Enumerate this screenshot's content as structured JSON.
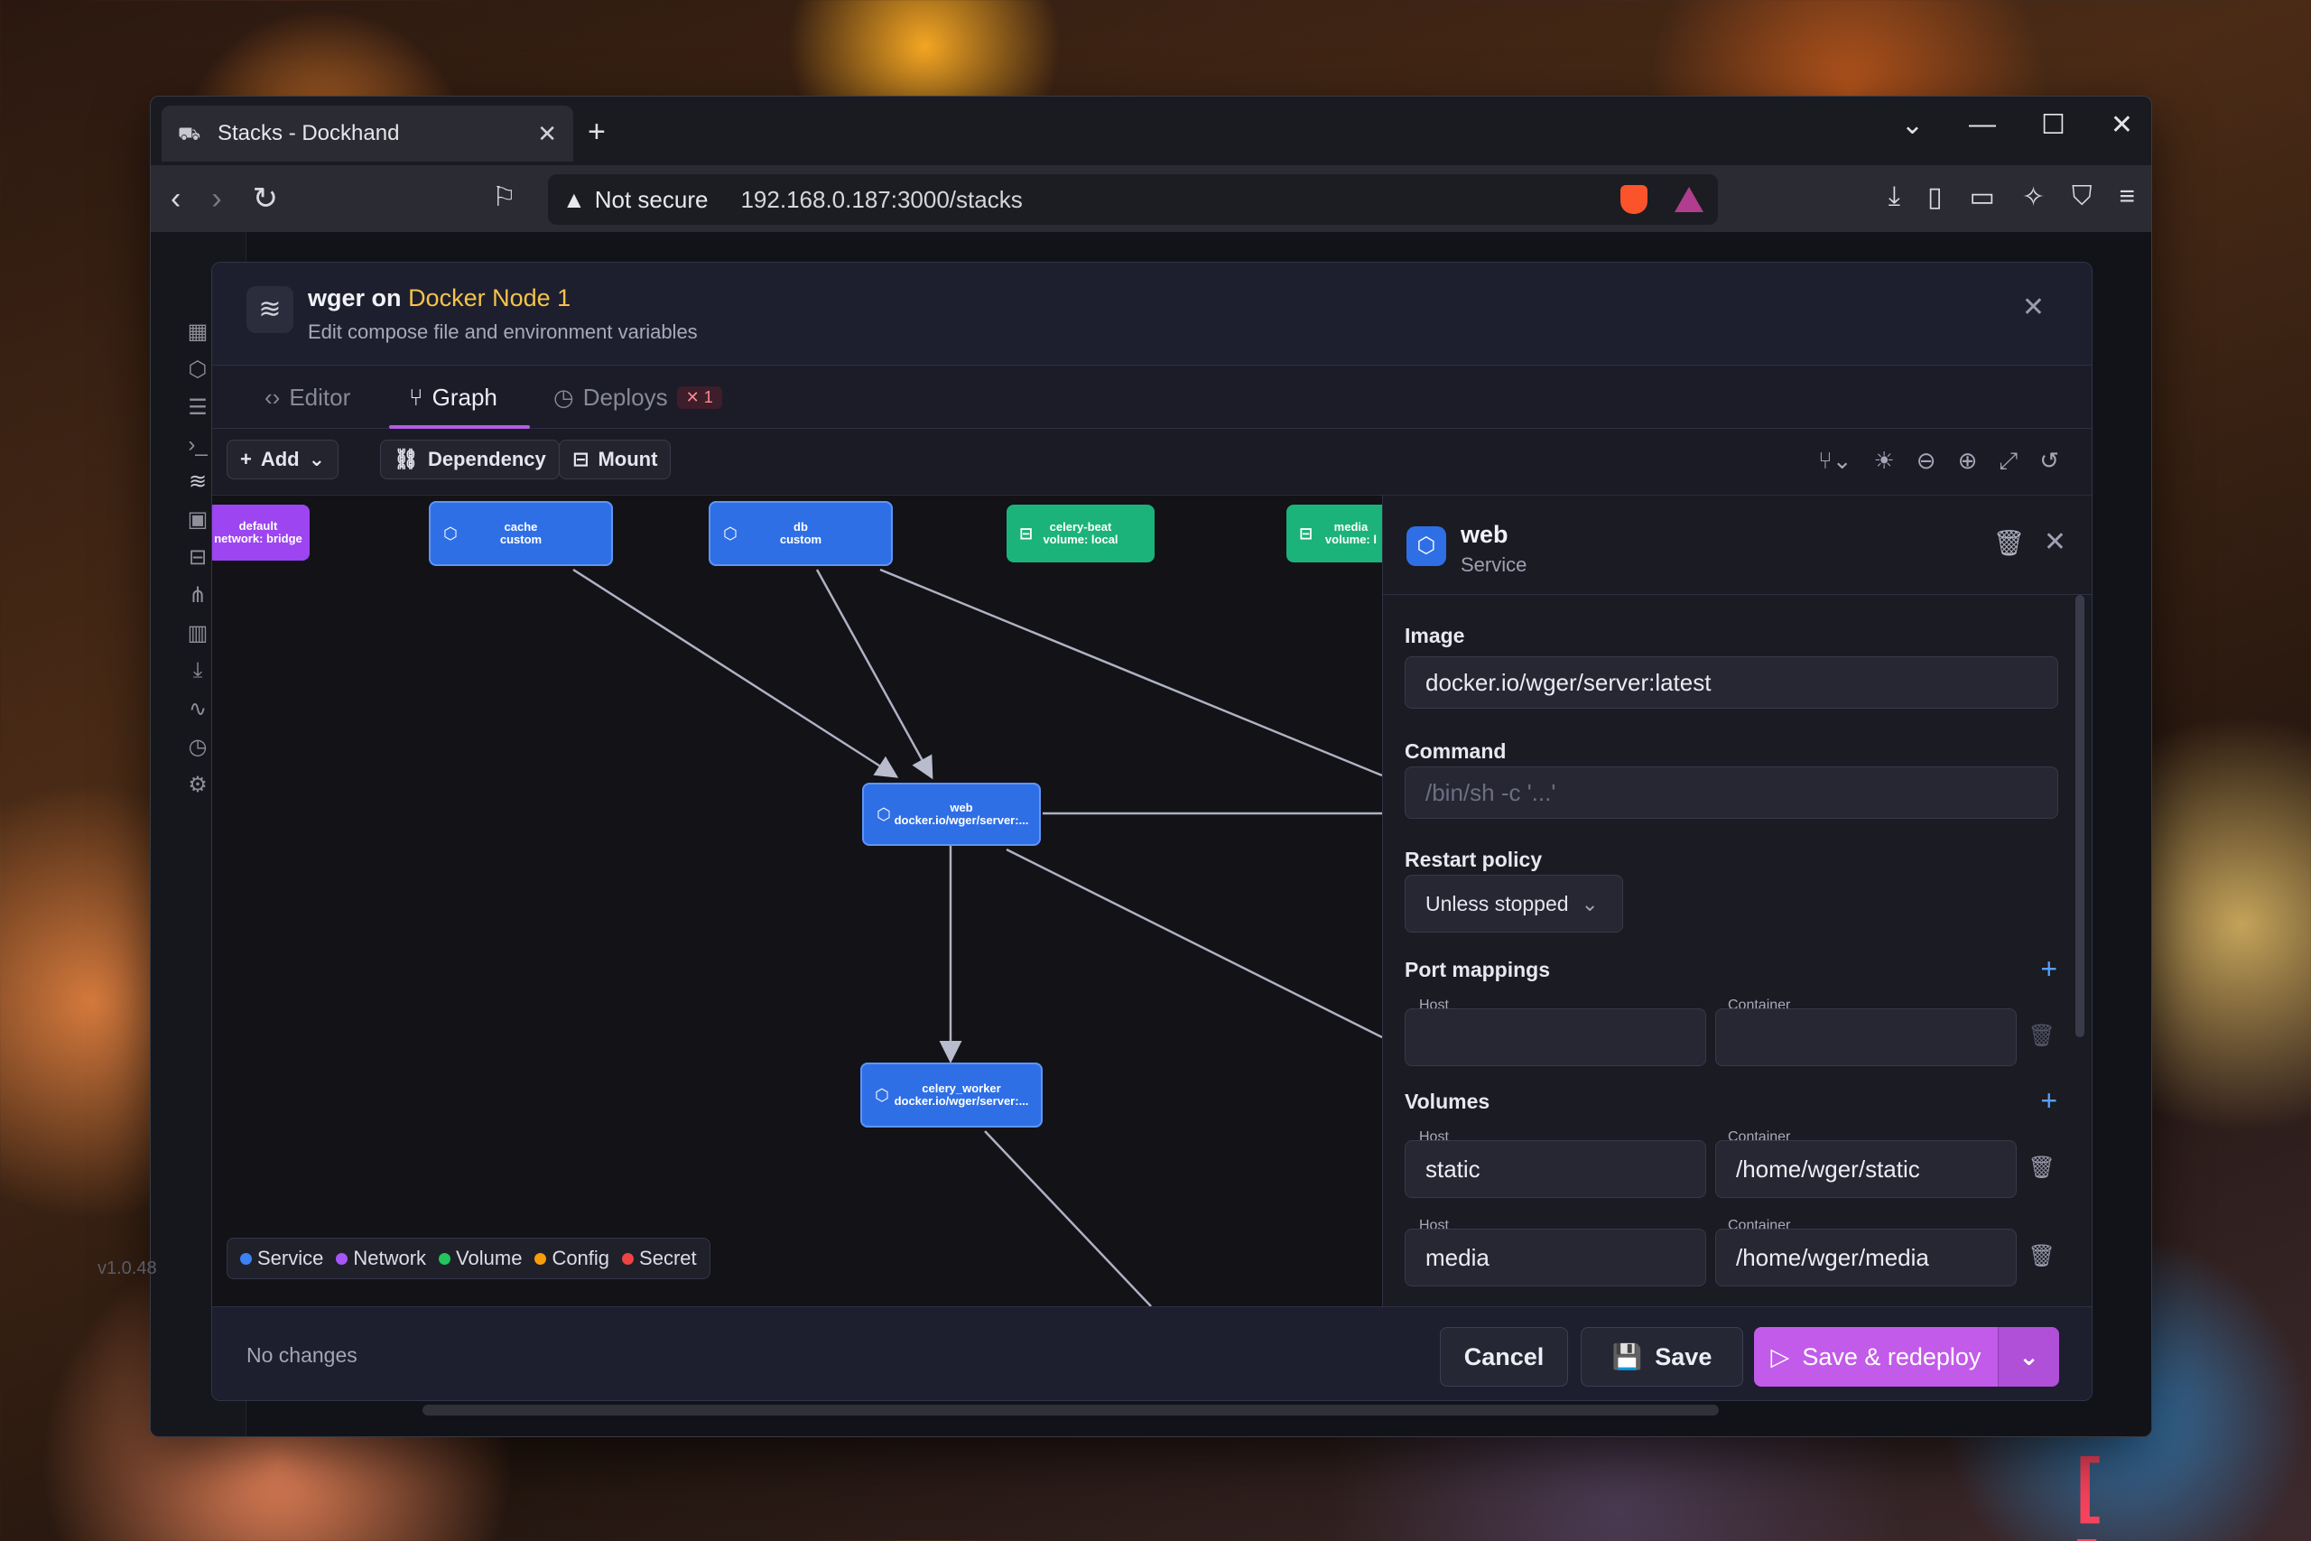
{
  "browser": {
    "tab_title": "Stacks - Dockhand",
    "address_warning": "Not secure",
    "url": "192.168.0.187:3000/stacks"
  },
  "app": {
    "version": "v1.0.48"
  },
  "modal": {
    "stack_name": "wger",
    "on_word": "on",
    "node_name": "Docker Node 1",
    "subtitle": "Edit compose file and environment variables",
    "tabs": [
      {
        "label": "Editor"
      },
      {
        "label": "Graph"
      },
      {
        "label": "Deploys"
      }
    ],
    "deploys_badge": "✕ 1",
    "toolbar": {
      "add_label": "Add",
      "dependency_label": "Dependency",
      "mount_label": "Mount"
    },
    "graph": {
      "nodes": [
        {
          "id": "default",
          "line1": "default",
          "line2": "network: bridge",
          "kind": "network"
        },
        {
          "id": "cache",
          "line1": "cache",
          "line2": "custom",
          "kind": "service"
        },
        {
          "id": "db",
          "line1": "db",
          "line2": "custom",
          "kind": "service"
        },
        {
          "id": "celery_beat",
          "line1": "celery-beat",
          "line2": "volume: local",
          "kind": "volume"
        },
        {
          "id": "media",
          "line1": "media",
          "line2": "volume: l",
          "kind": "volume"
        },
        {
          "id": "web",
          "line1": "web",
          "line2": "docker.io/wger/server:...",
          "kind": "service"
        },
        {
          "id": "celery_worker",
          "line1": "celery_worker",
          "line2": "docker.io/wger/server:...",
          "kind": "service"
        }
      ]
    },
    "legend": [
      {
        "label": "Service",
        "color": "#3b82f6"
      },
      {
        "label": "Network",
        "color": "#a855f7"
      },
      {
        "label": "Volume",
        "color": "#22c55e"
      },
      {
        "label": "Config",
        "color": "#f59e0b"
      },
      {
        "label": "Secret",
        "color": "#ef4444"
      }
    ],
    "panel": {
      "name": "web",
      "type": "Service",
      "image_label": "Image",
      "image_value": "docker.io/wger/server:latest",
      "command_label": "Command",
      "command_placeholder": "/bin/sh -c '...'",
      "restart_label": "Restart policy",
      "restart_value": "Unless stopped",
      "ports_label": "Port mappings",
      "host_label": "Host",
      "container_label": "Container",
      "volumes_label": "Volumes",
      "volumes": [
        {
          "host": "static",
          "container": "/home/wger/static"
        },
        {
          "host": "media",
          "container": "/home/wger/media"
        }
      ]
    },
    "footer": {
      "status": "No changes",
      "cancel_label": "Cancel",
      "save_label": "Save",
      "deploy_label": "Save & redeploy"
    }
  },
  "watermark": "XDA"
}
